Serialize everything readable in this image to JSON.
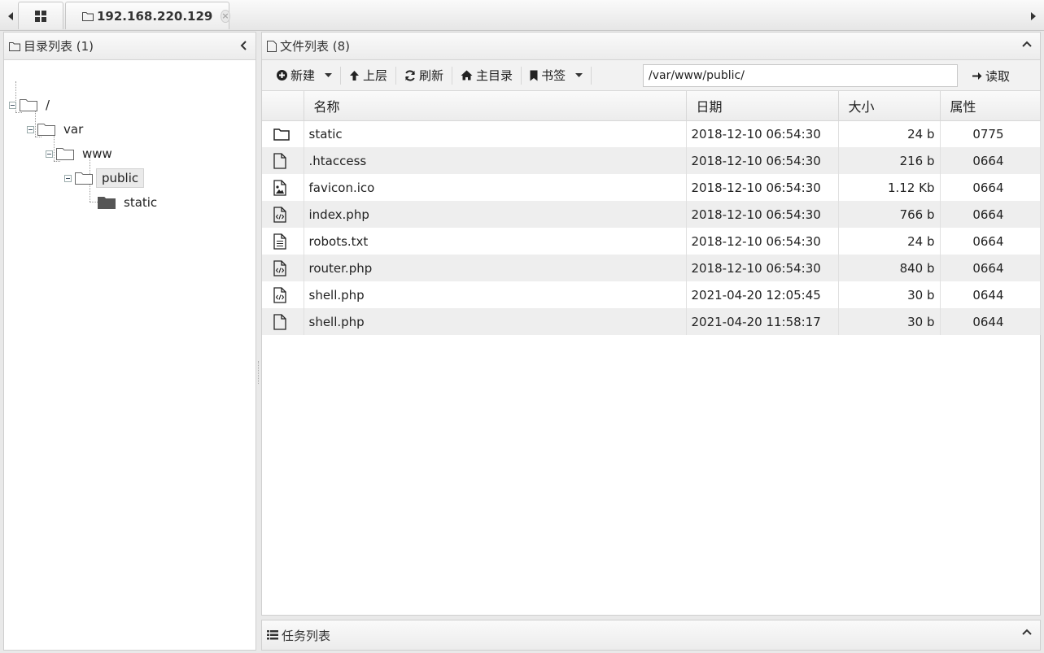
{
  "tabs": {
    "host_tab_label": "192.168.220.129",
    "close_glyph": "×"
  },
  "left_panel": {
    "title": "目录列表 (1)"
  },
  "tree": {
    "root": "/",
    "var": "var",
    "www": "www",
    "public": "public",
    "static": "static"
  },
  "right_panel": {
    "title": "文件列表 (8)"
  },
  "toolbar": {
    "new_label": "新建",
    "up_label": "上层",
    "refresh_label": "刷新",
    "home_label": "主目录",
    "bookmark_label": "书签",
    "path_value": "/var/www/public/",
    "read_label": "读取"
  },
  "table": {
    "headers": [
      "名称",
      "日期",
      "大小",
      "属性"
    ],
    "rows": [
      {
        "icon": "folder-icon",
        "name": "static",
        "date": "2018-12-10 06:54:30",
        "size": "24 b",
        "attr": "0775"
      },
      {
        "icon": "file-icon",
        "name": ".htaccess",
        "date": "2018-12-10 06:54:30",
        "size": "216 b",
        "attr": "0664"
      },
      {
        "icon": "image-file-icon",
        "name": "favicon.ico",
        "date": "2018-12-10 06:54:30",
        "size": "1.12 Kb",
        "attr": "0664"
      },
      {
        "icon": "code-file-icon",
        "name": "index.php",
        "date": "2018-12-10 06:54:30",
        "size": "766 b",
        "attr": "0664"
      },
      {
        "icon": "text-file-icon",
        "name": "robots.txt",
        "date": "2018-12-10 06:54:30",
        "size": "24 b",
        "attr": "0664"
      },
      {
        "icon": "code-file-icon",
        "name": "router.php",
        "date": "2018-12-10 06:54:30",
        "size": "840 b",
        "attr": "0664"
      },
      {
        "icon": "code-file-icon",
        "name": "shell.php",
        "date": "2021-04-20 12:05:45",
        "size": "30 b",
        "attr": "0644"
      },
      {
        "icon": "file-icon",
        "name": "shell.php",
        "date": "2021-04-20 11:58:17",
        "size": "30 b",
        "attr": "0644"
      }
    ]
  },
  "task_panel": {
    "title": "任务列表"
  }
}
